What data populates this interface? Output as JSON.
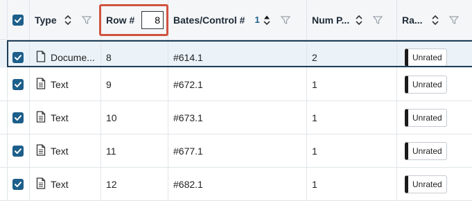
{
  "header": {
    "type_label": "Type",
    "row_label": "Row #",
    "row_input_value": "8",
    "bates_label": "Bates/Control #",
    "bates_sort_order": "1",
    "num_pages_label": "Num P...",
    "rating_label": "Ra..."
  },
  "rows": [
    {
      "type": "Docume...",
      "row": "8",
      "bates": "#614.1",
      "pages": "2",
      "rating": "Unrated"
    },
    {
      "type": "Text",
      "row": "9",
      "bates": "#672.1",
      "pages": "1",
      "rating": "Unrated"
    },
    {
      "type": "Text",
      "row": "10",
      "bates": "#673.1",
      "pages": "1",
      "rating": "Unrated"
    },
    {
      "type": "Text",
      "row": "11",
      "bates": "#677.1",
      "pages": "1",
      "rating": "Unrated"
    },
    {
      "type": "Text",
      "row": "12",
      "bates": "#682.1",
      "pages": "1",
      "rating": "Unrated"
    }
  ],
  "colors": {
    "accent": "#1d5f8a",
    "focus_border": "#d0533f",
    "selected_row": "#ebf3f8"
  },
  "icons": [
    "checkbox-checked-icon",
    "sort-icon",
    "filter-icon",
    "document-icon",
    "text-file-icon"
  ]
}
